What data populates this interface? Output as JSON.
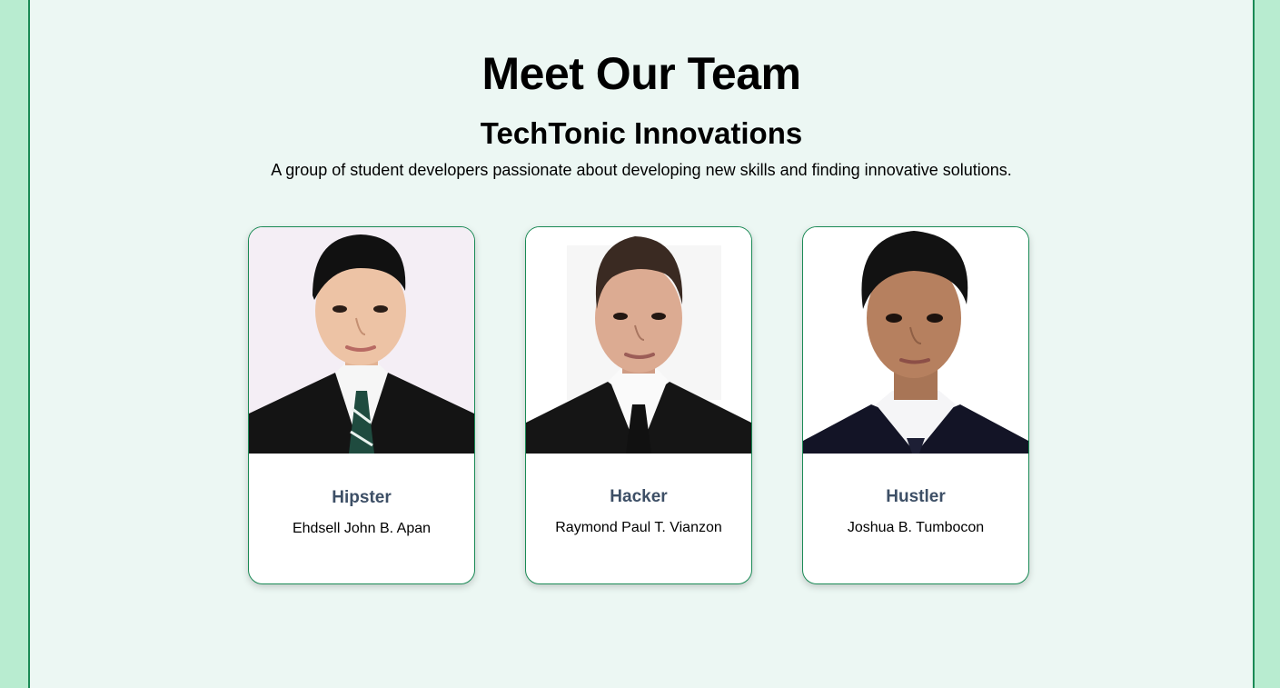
{
  "header": {
    "title": "Meet Our Team",
    "team_name": "TechTonic Innovations",
    "description": "A group of student developers passionate about developing new skills and finding innovative solutions."
  },
  "members": [
    {
      "role": "Hipster",
      "name": "Ehdsell John B. Apan"
    },
    {
      "role": "Hacker",
      "name": "Raymond Paul T. Vianzon"
    },
    {
      "role": "Hustler",
      "name": "Joshua B. Tumbocon"
    }
  ],
  "colors": {
    "page_bg": "#b8ecd0",
    "panel_bg": "#ecf7f3",
    "accent": "#1a8a55",
    "role_text": "#3d4f66"
  }
}
